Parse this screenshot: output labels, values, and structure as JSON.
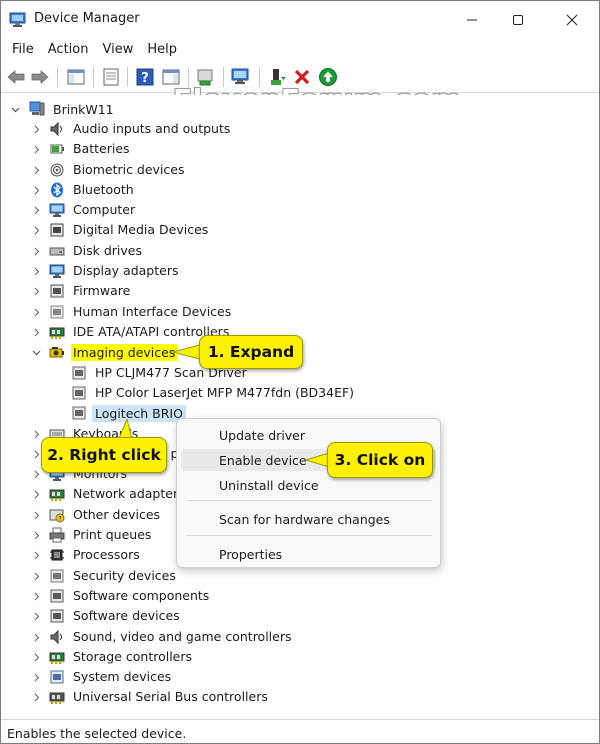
{
  "window": {
    "title": "Device Manager"
  },
  "menu": [
    "File",
    "Action",
    "View",
    "Help"
  ],
  "watermark": "ElevenForum.com",
  "tree": {
    "root": "BrinkW11",
    "categories": [
      {
        "label": "Audio inputs and outputs",
        "icon": "speaker-icon"
      },
      {
        "label": "Batteries",
        "icon": "battery-icon"
      },
      {
        "label": "Biometric devices",
        "icon": "fingerprint-icon"
      },
      {
        "label": "Bluetooth",
        "icon": "bluetooth-icon"
      },
      {
        "label": "Computer",
        "icon": "computer-icon"
      },
      {
        "label": "Digital Media Devices",
        "icon": "media-device-icon"
      },
      {
        "label": "Disk drives",
        "icon": "disk-drive-icon"
      },
      {
        "label": "Display adapters",
        "icon": "display-adapter-icon"
      },
      {
        "label": "Firmware",
        "icon": "firmware-icon"
      },
      {
        "label": "Human Interface Devices",
        "icon": "hid-icon"
      },
      {
        "label": "IDE ATA/ATAPI controllers",
        "icon": "ide-controller-icon"
      },
      {
        "label": "Imaging devices",
        "icon": "camera-icon"
      },
      {
        "label": "Keyboards",
        "icon": "keyboard-icon"
      },
      {
        "label": "Mice and other pointing devices",
        "icon": "mouse-icon"
      },
      {
        "label": "Monitors",
        "icon": "monitor-icon"
      },
      {
        "label": "Network adapters",
        "icon": "network-adapter-icon"
      },
      {
        "label": "Other devices",
        "icon": "other-devices-icon"
      },
      {
        "label": "Print queues",
        "icon": "printer-icon"
      },
      {
        "label": "Processors",
        "icon": "processor-icon"
      },
      {
        "label": "Security devices",
        "icon": "security-device-icon"
      },
      {
        "label": "Software components",
        "icon": "software-component-icon"
      },
      {
        "label": "Software devices",
        "icon": "software-device-icon"
      },
      {
        "label": "Sound, video and game controllers",
        "icon": "sound-icon"
      },
      {
        "label": "Storage controllers",
        "icon": "storage-controller-icon"
      },
      {
        "label": "System devices",
        "icon": "system-device-icon"
      },
      {
        "label": "Universal Serial Bus controllers",
        "icon": "usb-icon"
      }
    ],
    "imaging_children": [
      {
        "label": "HP CLJM477 Scan Driver",
        "icon": "scanner-icon"
      },
      {
        "label": "HP Color LaserJet MFP M477fdn (BD34EF)",
        "icon": "scanner-icon"
      },
      {
        "label": "Logitech BRIO",
        "icon": "webcam-disabled-icon"
      }
    ]
  },
  "context_menu": {
    "items": [
      "Update driver",
      "Enable device",
      "Uninstall device",
      "Scan for hardware changes",
      "Properties"
    ]
  },
  "callouts": {
    "expand": "1. Expand",
    "right_click": "2. Right click",
    "click_on": "3. Click on"
  },
  "status_bar": "Enables the selected device.",
  "colors": {
    "callout": "#fff200",
    "selection": "#cce4f7",
    "highlight": "#ffff00"
  }
}
